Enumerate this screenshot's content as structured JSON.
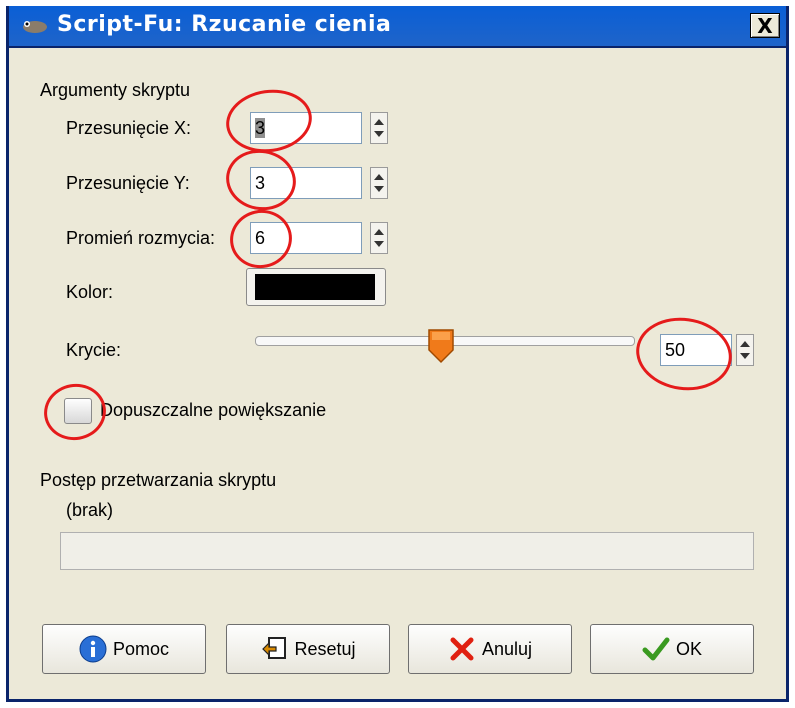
{
  "window": {
    "title": "Script-Fu: Rzucanie cienia",
    "close_label": "X"
  },
  "section_args": "Argumenty skryptu",
  "fields": {
    "offset_x": {
      "label": "Przesunięcie X:",
      "value": "3"
    },
    "offset_y": {
      "label": "Przesunięcie Y:",
      "value": "3"
    },
    "blur_radius": {
      "label": "Promień rozmycia:",
      "value": "6"
    },
    "color": {
      "label": "Kolor:",
      "value": "#000000"
    },
    "opacity": {
      "label": "Krycie:",
      "value": "50",
      "slider_fraction": 0.5
    },
    "allow_resize": {
      "label": "Dopuszczalne powiększanie",
      "checked": false
    }
  },
  "progress": {
    "heading": "Postęp przetwarzania skryptu",
    "status": "(brak)"
  },
  "buttons": {
    "help": "Pomoc",
    "reset": "Resetuj",
    "cancel": "Anuluj",
    "ok": "OK"
  },
  "colors": {
    "titlebar": "#0a5fd6",
    "dialog_bg": "#ece9d8",
    "annotation_circle": "#e51b1b",
    "slider_thumb": "#f07a1a"
  }
}
